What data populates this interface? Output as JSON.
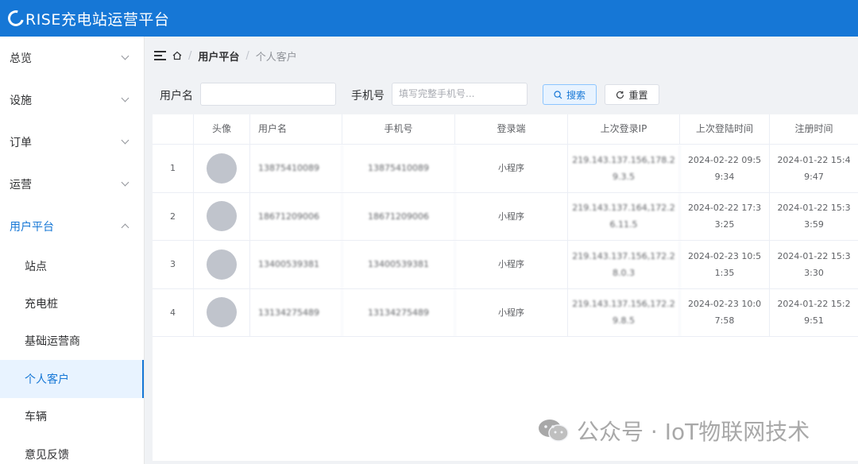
{
  "header": {
    "title": "RISE充电站运营平台"
  },
  "sidebar": {
    "menus": [
      {
        "label": "总览"
      },
      {
        "label": "设施"
      },
      {
        "label": "订单"
      },
      {
        "label": "运营"
      },
      {
        "label": "用户平台"
      }
    ],
    "submenu": [
      {
        "label": "站点"
      },
      {
        "label": "充电桩"
      },
      {
        "label": "基础运营商"
      },
      {
        "label": "个人客户"
      },
      {
        "label": "车辆"
      },
      {
        "label": "意见反馈"
      }
    ]
  },
  "breadcrumb": {
    "parent": "用户平台",
    "current": "个人客户",
    "separator": "/"
  },
  "search": {
    "username_label": "用户名",
    "username_value": "",
    "phone_label": "手机号",
    "phone_placeholder": "填写完整手机号...",
    "search_button": "搜索",
    "reset_button": "重置"
  },
  "table": {
    "columns": [
      "",
      "头像",
      "用户名",
      "手机号",
      "登录端",
      "上次登录IP",
      "上次登陆时间",
      "注册时间"
    ],
    "rows": [
      {
        "index": "1",
        "username": "13875410089",
        "phone": "13875410089",
        "client": "小程序",
        "ip": "219.143.137.156,178.2 9.3.5",
        "last_login": "2024-02-22 09:5 9:34",
        "registered": "2024-01-22 15:4 9:47"
      },
      {
        "index": "2",
        "username": "18671209006",
        "phone": "18671209006",
        "client": "小程序",
        "ip": "219.143.137.164,172.2 6.11.5",
        "last_login": "2024-02-22 17:3 3:25",
        "registered": "2024-01-22 15:3 3:59"
      },
      {
        "index": "3",
        "username": "13400539381",
        "phone": "13400539381",
        "client": "小程序",
        "ip": "219.143.137.156,172.2 8.0.3",
        "last_login": "2024-02-23 10:5 1:35",
        "registered": "2024-01-22 15:3 3:30"
      },
      {
        "index": "4",
        "username": "13134275489",
        "phone": "13134275489",
        "client": "小程序",
        "ip": "219.143.137.156,172.2 9.8.5",
        "last_login": "2024-02-23 10:0 7:58",
        "registered": "2024-01-22 15:2 9:51"
      }
    ]
  },
  "watermark": {
    "text": "公众号 · IoT物联网技术"
  },
  "colors": {
    "primary": "#1677d6",
    "avatar": "#c0c4cc"
  }
}
